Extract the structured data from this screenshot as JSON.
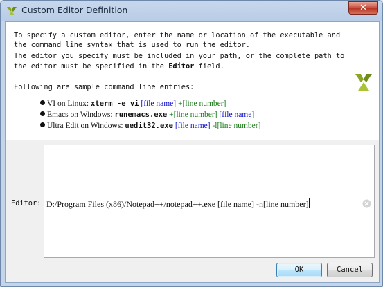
{
  "window": {
    "title": "Custom Editor Definition",
    "close_label": "✕"
  },
  "info": {
    "lines": [
      "To specify a custom editor, enter the name or location of the executable and",
      "the command line syntax that is used to run the editor.",
      "The editor you specify must be included in your path, or the complete path to"
    ],
    "line4_prefix": "the editor must be specified in the ",
    "line4_bold": "Editor",
    "line4_suffix": " field.",
    "samples_heading": "Following are sample command line entries:",
    "samples": [
      {
        "label": "VI on Linux: ",
        "command": "xterm -e vi",
        "sep": " ",
        "arg1": "[file name]",
        "mid": " +",
        "arg2": "[line number]",
        "tail": ""
      },
      {
        "label": "Emacs on Windows: ",
        "command": "runemacs.exe",
        "sep": " +",
        "arg1": "[line number]",
        "mid": " ",
        "arg2": "[file name]",
        "tail": ""
      },
      {
        "label": "Ultra Edit on Windows: ",
        "command": "uedit32.exe",
        "sep": " ",
        "arg1": "[file name]",
        "mid": " -l",
        "arg2": "[line number]",
        "tail": ""
      }
    ]
  },
  "editor": {
    "label": "Editor:",
    "value": "D:/Program Files (x86)/Notepad++/notepad++.exe [file name] -n[line number]"
  },
  "buttons": {
    "ok": "OK",
    "cancel": "Cancel"
  }
}
